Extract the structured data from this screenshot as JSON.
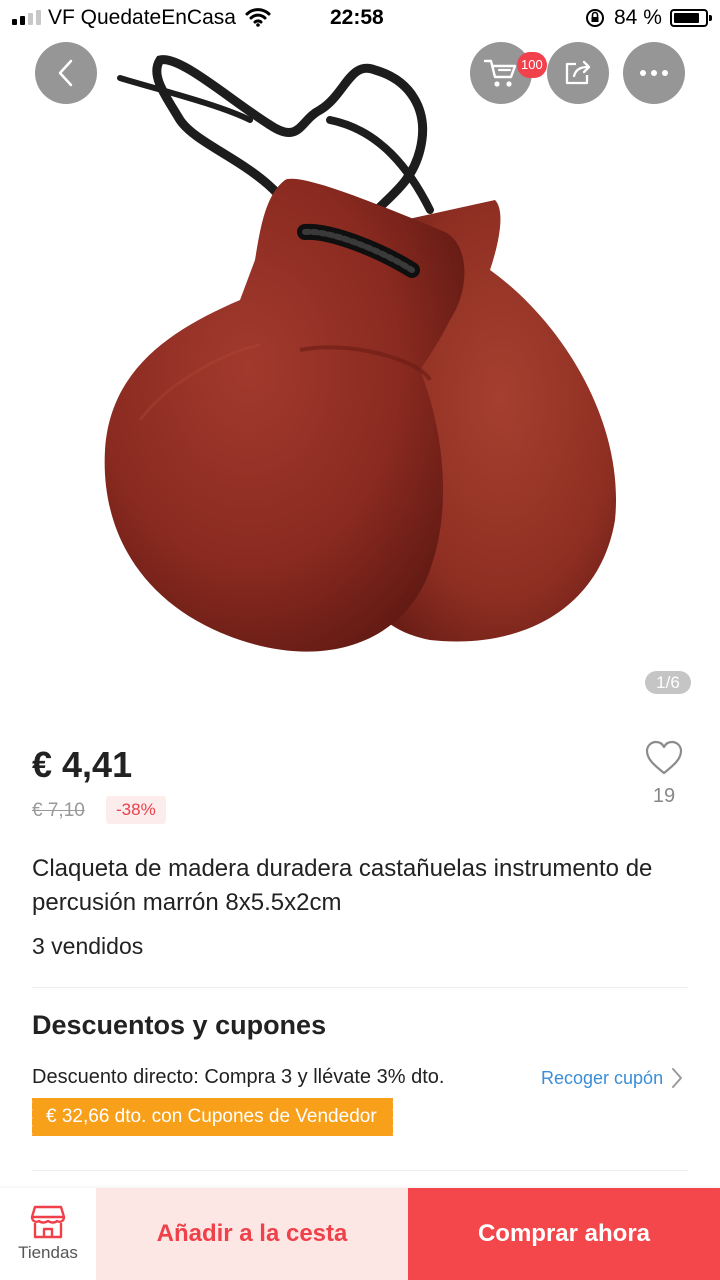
{
  "status_bar": {
    "carrier": "VF QuedateEnCasa",
    "time": "22:58",
    "battery_percent": "84 %",
    "battery_level": 0.84
  },
  "header": {
    "cart_badge": "100"
  },
  "gallery": {
    "pager": "1/6"
  },
  "product": {
    "price": "€ 4,41",
    "old_price": "€ 7,10",
    "discount": "-38%",
    "wishlist_count": "19",
    "title": "Claqueta de madera duradera castañuelas instrumento de percusión marrón 8x5.5x2cm",
    "sold": "3 vendidos"
  },
  "discounts": {
    "title": "Descuentos y cupones",
    "promo": "Descuento directo: Compra 3 y llévate 3% dto.",
    "collect_label": "Recoger cupón",
    "seller_coupon": "€ 32,66 dto. con Cupones de Vendedor"
  },
  "bottom_bar": {
    "store_label": "Tiendas",
    "add_to_cart": "Añadir a la cesta",
    "buy_now": "Comprar ahora"
  },
  "colors": {
    "accent_red": "#f3474b",
    "coupon_orange": "#f9a01b",
    "link_blue": "#3b8ed6",
    "castanet_brown": "#8b2a20"
  }
}
